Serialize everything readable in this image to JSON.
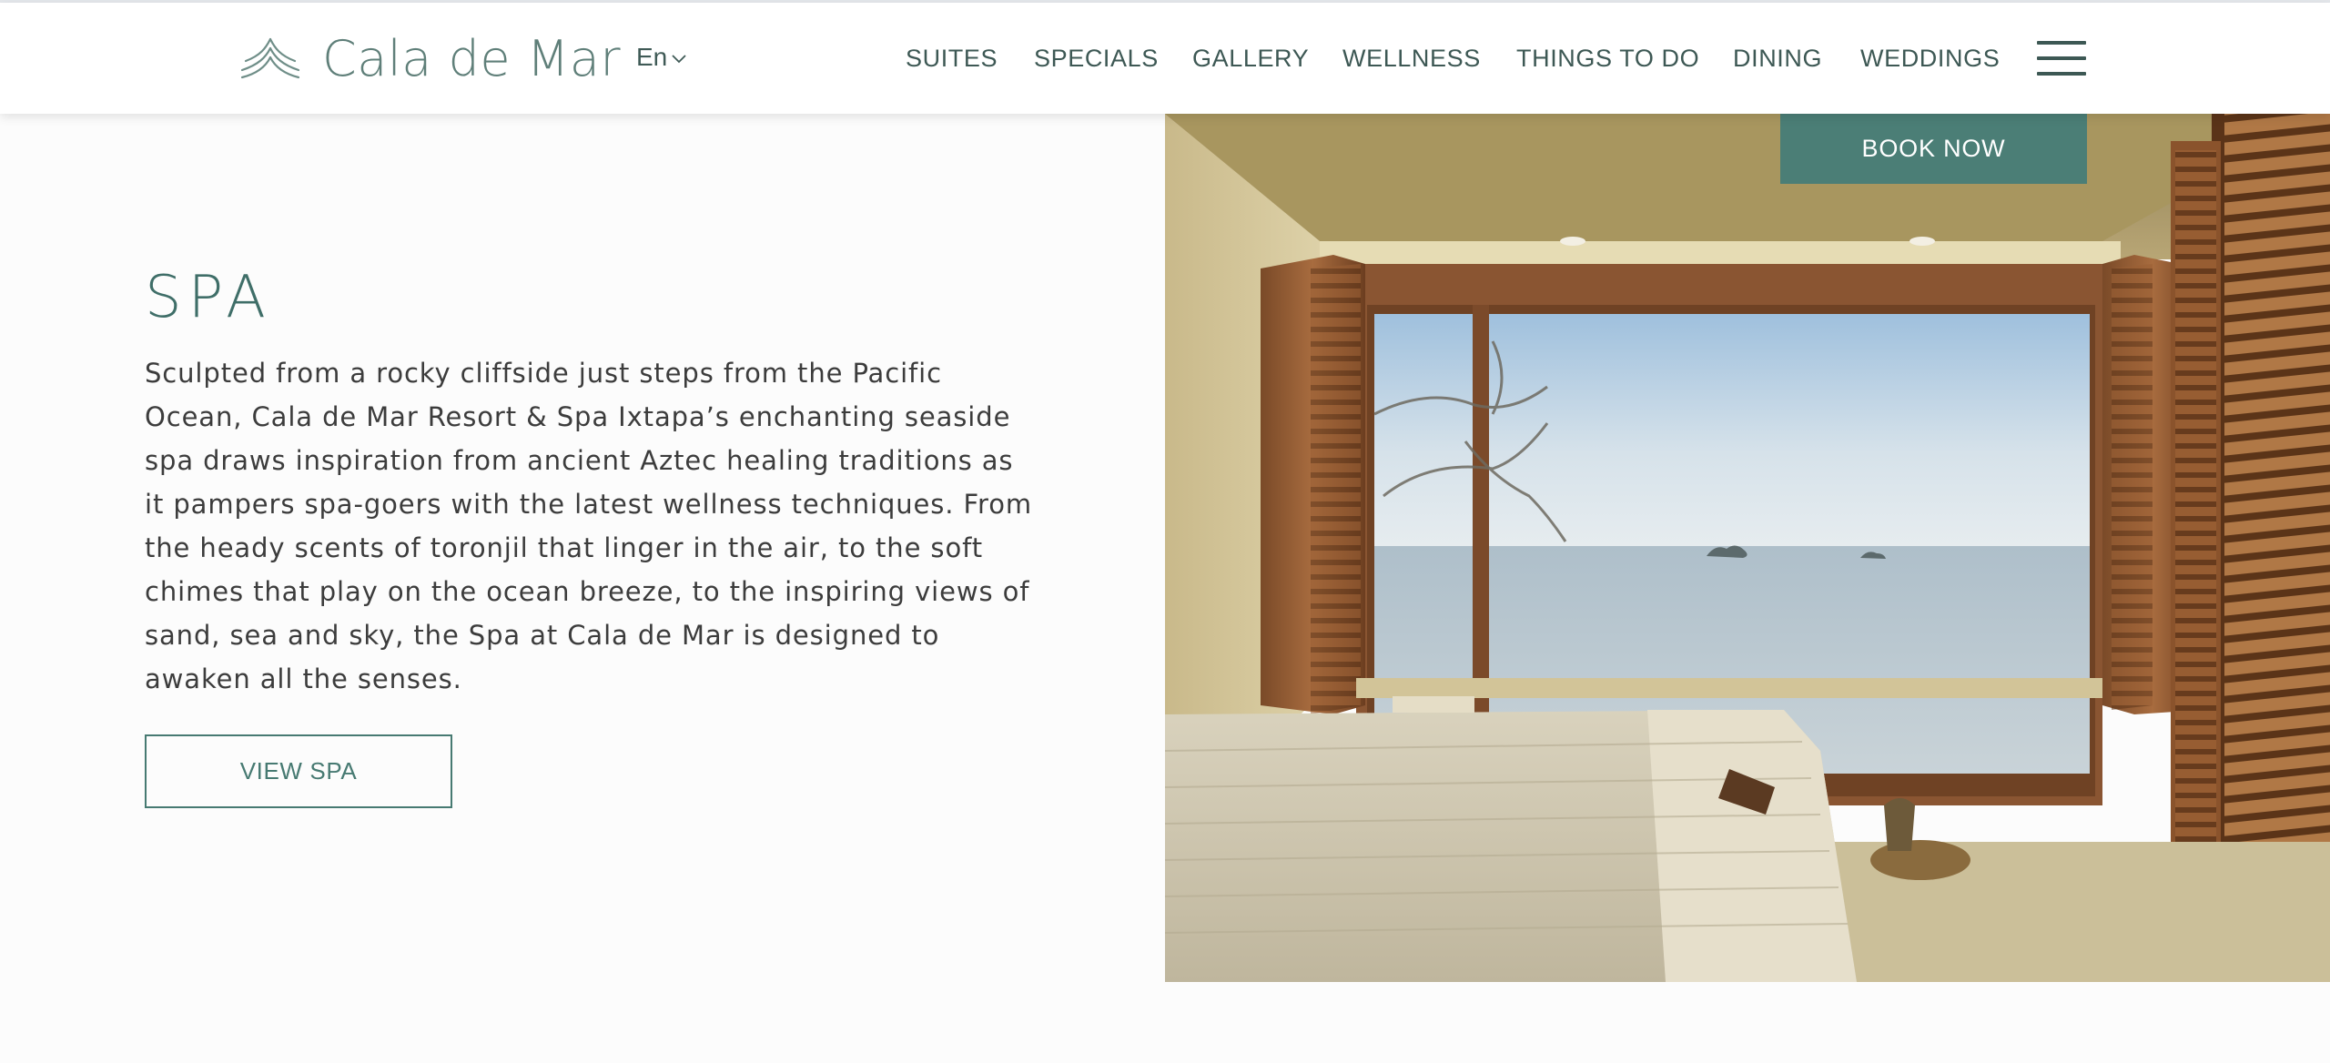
{
  "header": {
    "logo_text": "Cala de Mar",
    "language": "En",
    "nav": [
      "SUITES",
      "SPECIALS",
      "GALLERY",
      "WELLNESS",
      "THINGS TO DO",
      "DINING",
      "WEDDINGS"
    ],
    "menu_icon": "hamburger-menu-icon"
  },
  "hero": {
    "book_now_label": "BOOK NOW"
  },
  "spa": {
    "title": "SPA",
    "description": "Sculpted from a rocky cliffside just steps from the Pacific Ocean, Cala de Mar Resort & Spa Ixtapa’s enchanting seaside spa draws inspiration from ancient Aztec healing traditions as it pampers spa-goers with the latest wellness techniques. From the heady scents of toronjil that linger in the air, to the soft chimes that play on the ocean breeze, to the inspiring views of sand, sea and sky, the Spa at Cala de Mar is designed to awaken all the senses.",
    "button_label": "VIEW SPA"
  },
  "colors": {
    "brand_teal": "#4b7e76",
    "text_teal": "#3d5854"
  }
}
